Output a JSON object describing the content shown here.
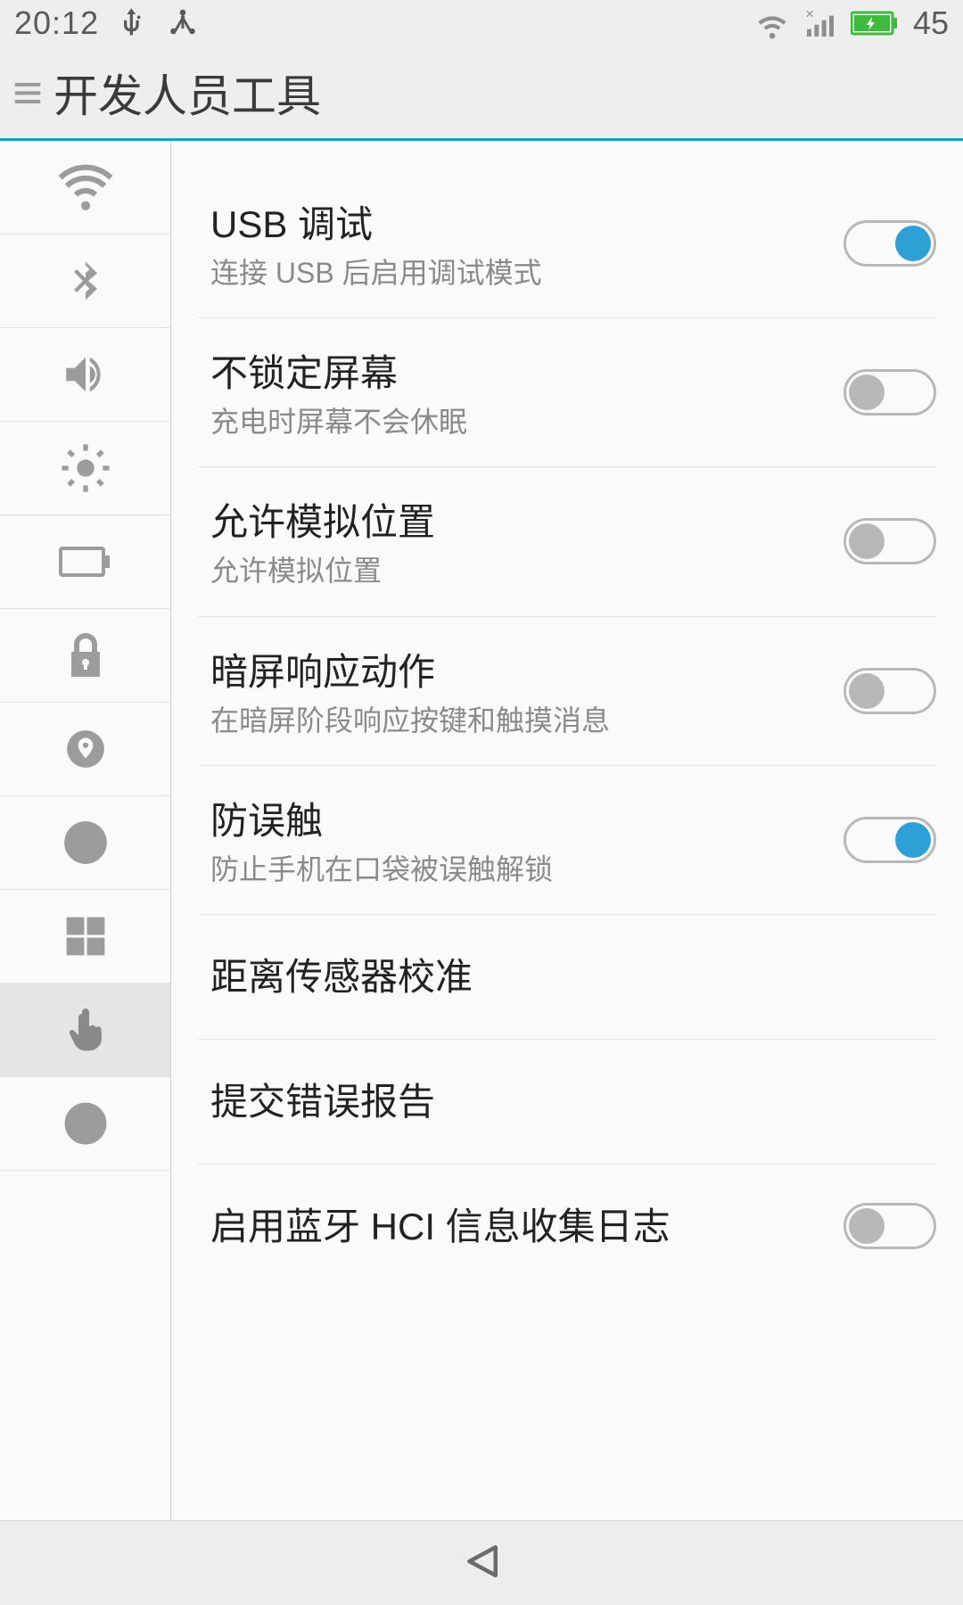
{
  "status": {
    "time": "20:12",
    "battery": "45"
  },
  "header": {
    "title": "开发人员工具"
  },
  "settings": [
    {
      "title": "USB 调试",
      "sub": "连接 USB 后启用调试模式",
      "toggle": "on"
    },
    {
      "title": "不锁定屏幕",
      "sub": "充电时屏幕不会休眠",
      "toggle": "off"
    },
    {
      "title": "允许模拟位置",
      "sub": "允许模拟位置",
      "toggle": "off"
    },
    {
      "title": "暗屏响应动作",
      "sub": "在暗屏阶段响应按键和触摸消息",
      "toggle": "off"
    },
    {
      "title": "防误触",
      "sub": "防止手机在口袋被误触解锁",
      "toggle": "on"
    },
    {
      "title": "距离传感器校准",
      "sub": "",
      "toggle": ""
    },
    {
      "title": "提交错误报告",
      "sub": "",
      "toggle": ""
    },
    {
      "title": "启用蓝牙 HCI 信息收集日志",
      "sub": "",
      "toggle": "off"
    }
  ]
}
